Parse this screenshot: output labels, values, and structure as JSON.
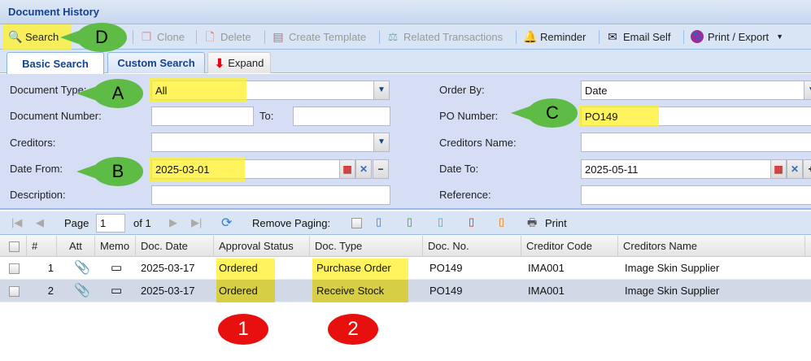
{
  "window": {
    "title": "Document History"
  },
  "toolbar": {
    "search": "Search",
    "clone": "Clone",
    "delete": "Delete",
    "create_template": "Create Template",
    "related_transactions": "Related Transactions",
    "reminder": "Reminder",
    "email_self": "Email Self",
    "print_export": "Print / Export"
  },
  "tabs": {
    "basic": "Basic Search",
    "custom": "Custom Search",
    "expand": "Expand"
  },
  "form": {
    "document_type_label": "Document Type:",
    "document_type_value": "All",
    "document_number_label": "Document Number:",
    "to_label": "To:",
    "document_number_value": "",
    "document_number_to": "",
    "creditors_label": "Creditors:",
    "creditors_value": "",
    "date_from_label": "Date From:",
    "date_from_value": "2025-03-01",
    "description_label": "Description:",
    "description_value": "",
    "order_by_label": "Order By:",
    "order_by_value": "Date",
    "po_number_label": "PO Number:",
    "po_number_value": "PO149",
    "creditors_name_label": "Creditors Name:",
    "creditors_name_value": "",
    "date_to_label": "Date To:",
    "date_to_value": "2025-05-11",
    "reference_label": "Reference:",
    "reference_value": ""
  },
  "pager": {
    "page_label": "Page",
    "page_value": "1",
    "of_label": "of 1",
    "remove_paging": "Remove Paging:",
    "print": "Print"
  },
  "grid": {
    "columns": [
      "#",
      "Att",
      "Memo",
      "Doc. Date",
      "Approval Status",
      "Doc. Type",
      "Doc. No.",
      "Creditor Code",
      "Creditors Name"
    ],
    "rows": [
      {
        "num": "1",
        "doc_date": "2025-03-17",
        "approval_status": "Ordered",
        "doc_type": "Purchase Order",
        "doc_no": "PO149",
        "creditor_code": "IMA001",
        "creditors_name": "Image Skin Supplier"
      },
      {
        "num": "2",
        "doc_date": "2025-03-17",
        "approval_status": "Ordered",
        "doc_type": "Receive Stock",
        "doc_no": "PO149",
        "creditor_code": "IMA001",
        "creditors_name": "Image Skin Supplier"
      }
    ]
  },
  "annotations": {
    "a": "A",
    "b": "B",
    "c": "C",
    "d": "D",
    "one": "1",
    "two": "2"
  },
  "colors": {
    "highlight": "#fff028",
    "callout": "#5dbb46",
    "badge": "#e8100e",
    "title": "#15428b"
  }
}
